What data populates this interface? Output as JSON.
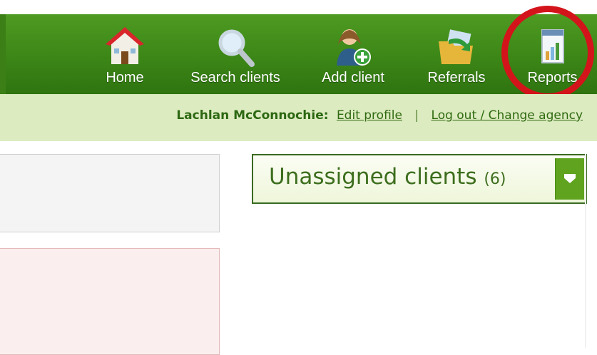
{
  "nav": {
    "items": [
      {
        "label": "Home",
        "icon": "house-icon"
      },
      {
        "label": "Search clients",
        "icon": "magnifier-icon"
      },
      {
        "label": "Add client",
        "icon": "add-person-icon"
      },
      {
        "label": "Referrals",
        "icon": "folder-arrow-icon"
      },
      {
        "label": "Reports",
        "icon": "report-chart-icon"
      }
    ],
    "highlight_color": "#d3141b",
    "bar_color": "#3f8a19"
  },
  "user": {
    "name": "Lachlan McConnochie:",
    "edit_profile": "Edit profile",
    "separator": "|",
    "logout": "Log out / Change agency"
  },
  "widget": {
    "title": "Unassigned clients",
    "count": "(6)"
  }
}
